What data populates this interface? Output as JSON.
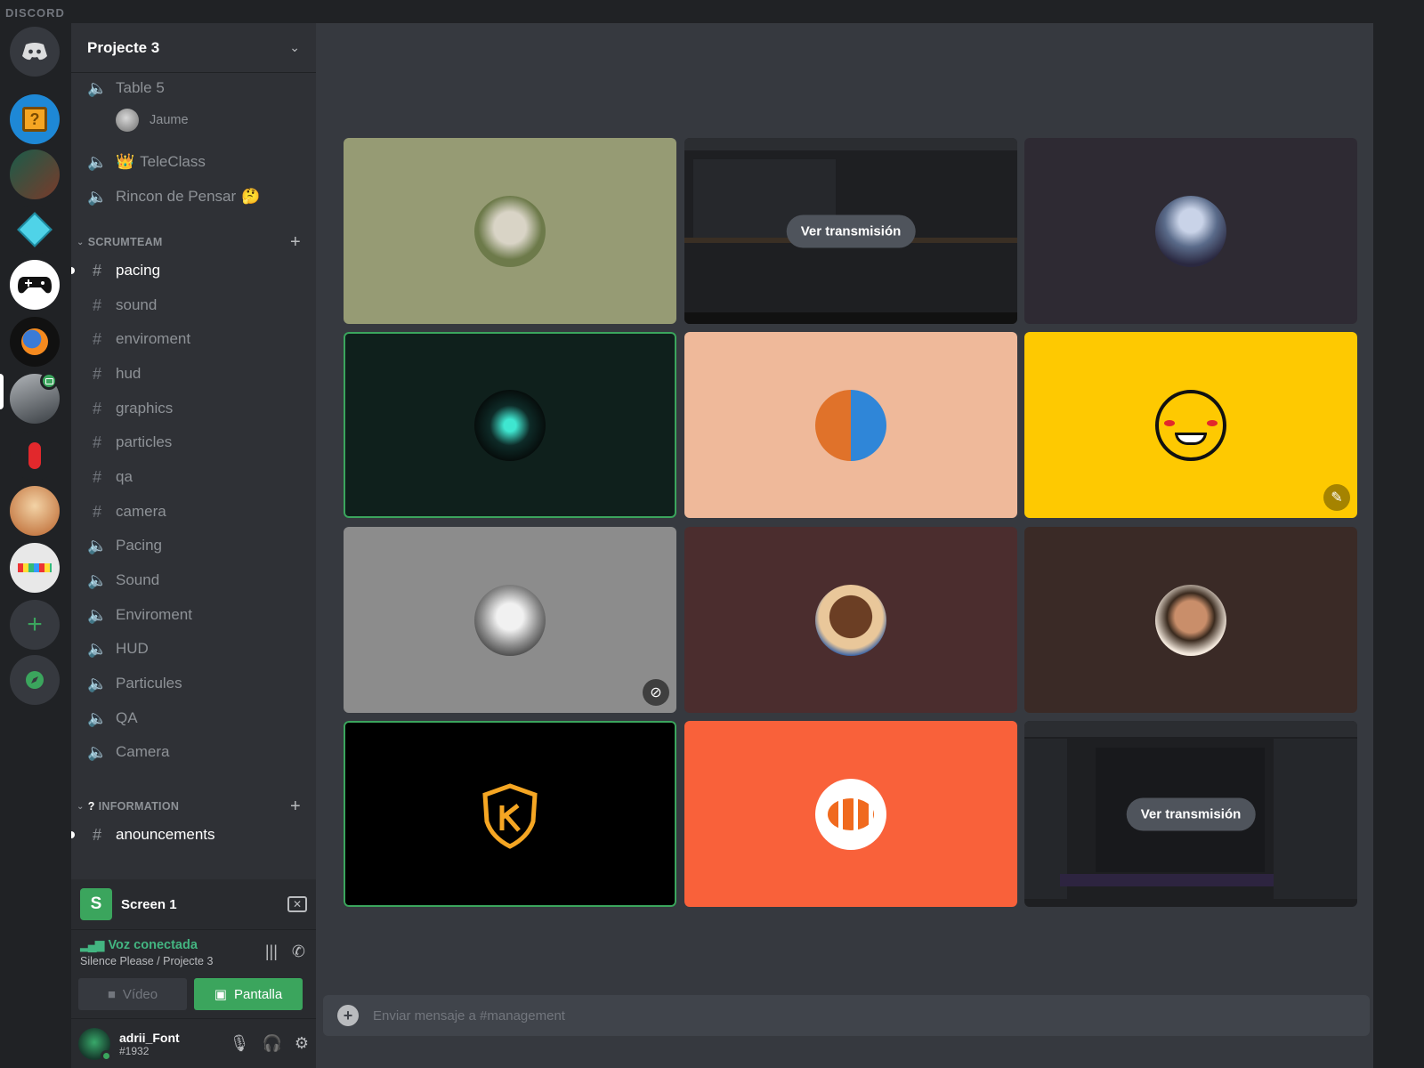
{
  "app": {
    "brand": "DISCORD"
  },
  "guild": {
    "name": "Projecte 3"
  },
  "channels": {
    "voice_top": [
      {
        "label": "Table 5",
        "emoji": ""
      },
      {
        "label": "TeleClass",
        "emoji": "👑"
      },
      {
        "label": "Rincon de Pensar",
        "emoji": "🤔"
      }
    ],
    "voice_user": "Jaume",
    "scrumteam_label": "SCRUMTEAM",
    "scrumteam_text": [
      "pacing",
      "sound",
      "enviroment",
      "hud",
      "graphics",
      "particles",
      "qa",
      "camera"
    ],
    "scrumteam_voice": [
      "Pacing",
      "Sound",
      "Enviroment",
      "HUD",
      "Particules",
      "QA",
      "Camera"
    ],
    "information_label": "INFORMATION",
    "information_text": [
      "anouncements"
    ]
  },
  "stream_panel": {
    "badge": "S",
    "title": "Screen 1"
  },
  "voice_panel": {
    "status": "Voz conectada",
    "location": "Silence Please / Projecte 3",
    "video_label": "Vídeo",
    "screen_label": "Pantalla"
  },
  "user": {
    "name": "adrii_Font",
    "tag": "#1932"
  },
  "tiles": {
    "watch_label": "Ver transmisión"
  },
  "chat": {
    "placeholder": "Enviar mensaje a #management"
  },
  "colors": {
    "accent_green": "#3ba55d",
    "tile_1": "#969b74",
    "tile_3": "#2e2a33",
    "tile_4": "#0f201c",
    "tile_5": "#efb99a",
    "tile_6": "#fec901",
    "tile_7": "#8c8c8c",
    "tile_8": "#4b2d2e",
    "tile_9": "#3a2a26",
    "tile_10": "#000000",
    "tile_11": "#f9613a"
  }
}
